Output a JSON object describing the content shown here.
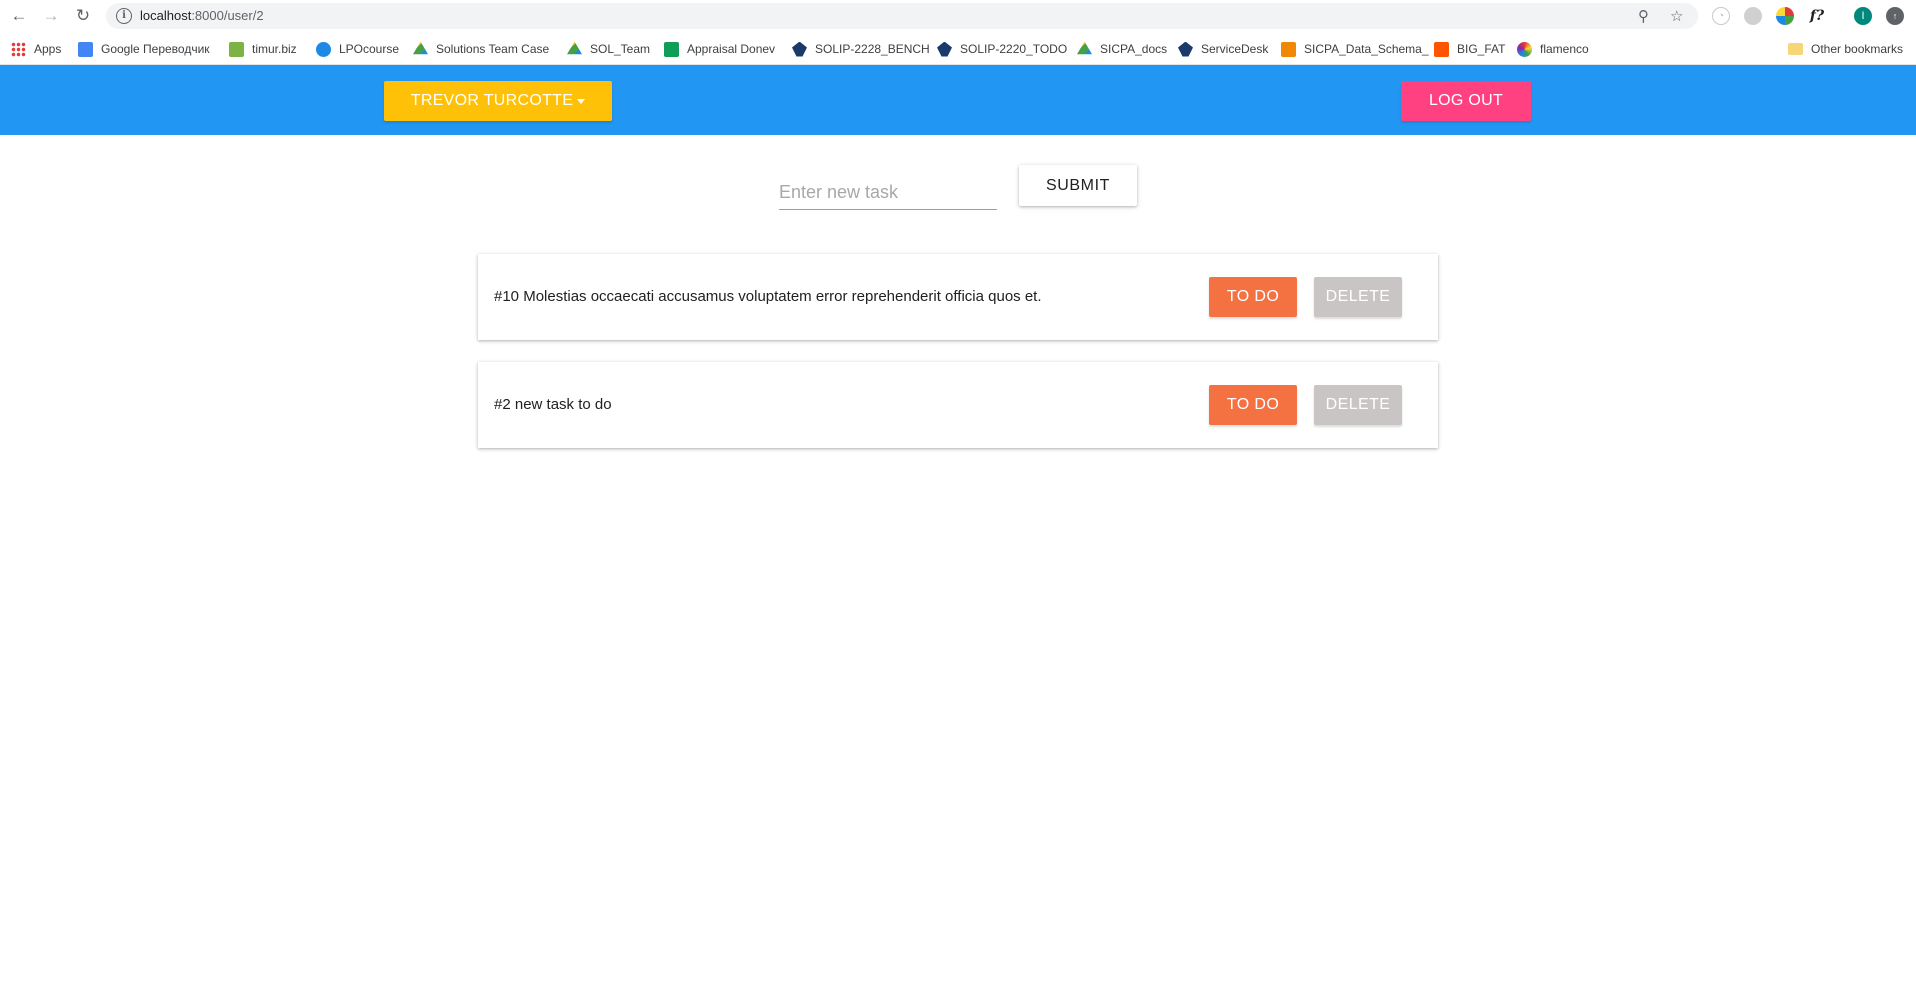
{
  "browser": {
    "url_host": "localhost",
    "url_path": ":8000/user/2",
    "bookmarks": [
      {
        "label": "Apps",
        "icon": "apps-grid-icon"
      },
      {
        "label": "Google Переводчик",
        "icon": "google-translate-icon"
      },
      {
        "label": "timur.biz",
        "icon": "mail-icon"
      },
      {
        "label": "LPOcourse",
        "icon": "lpo-icon"
      },
      {
        "label": "Solutions Team Case",
        "icon": "drive-icon"
      },
      {
        "label": "SOL_Team",
        "icon": "drive-icon"
      },
      {
        "label": "Appraisal Donev",
        "icon": "sheets-icon"
      },
      {
        "label": "SOLIP-2228_BENCH",
        "icon": "jira-icon"
      },
      {
        "label": "SOLIP-2220_TODO",
        "icon": "jira-icon"
      },
      {
        "label": "SICPA_docs",
        "icon": "drive-icon"
      },
      {
        "label": "ServiceDesk",
        "icon": "jira-icon"
      },
      {
        "label": "SICPA_Data_Schema_",
        "icon": "drawio-icon"
      },
      {
        "label": "BIG_FAT",
        "icon": "soundcloud-icon"
      },
      {
        "label": "flamenco",
        "icon": "flower-icon"
      }
    ],
    "other_bookmarks": "Other bookmarks",
    "profile_initial": "I"
  },
  "header": {
    "user_label": "TREVOR TURCOTTE",
    "logout_label": "LOG OUT"
  },
  "form": {
    "placeholder": "Enter new task",
    "value": "",
    "submit_label": "SUBMIT"
  },
  "tasks": [
    {
      "text": "#10 Molestias occaecati accusamus voluptatem error reprehenderit officia quos et.",
      "status_label": "TO DO",
      "delete_label": "DELETE"
    },
    {
      "text": "#2 new task to do",
      "status_label": "TO DO",
      "delete_label": "DELETE"
    }
  ],
  "colors": {
    "app_bar": "#2196f3",
    "user_button": "#ffc107",
    "logout_button": "#ff4081",
    "todo_button": "#f47142",
    "delete_button": "#c8c5c4"
  }
}
